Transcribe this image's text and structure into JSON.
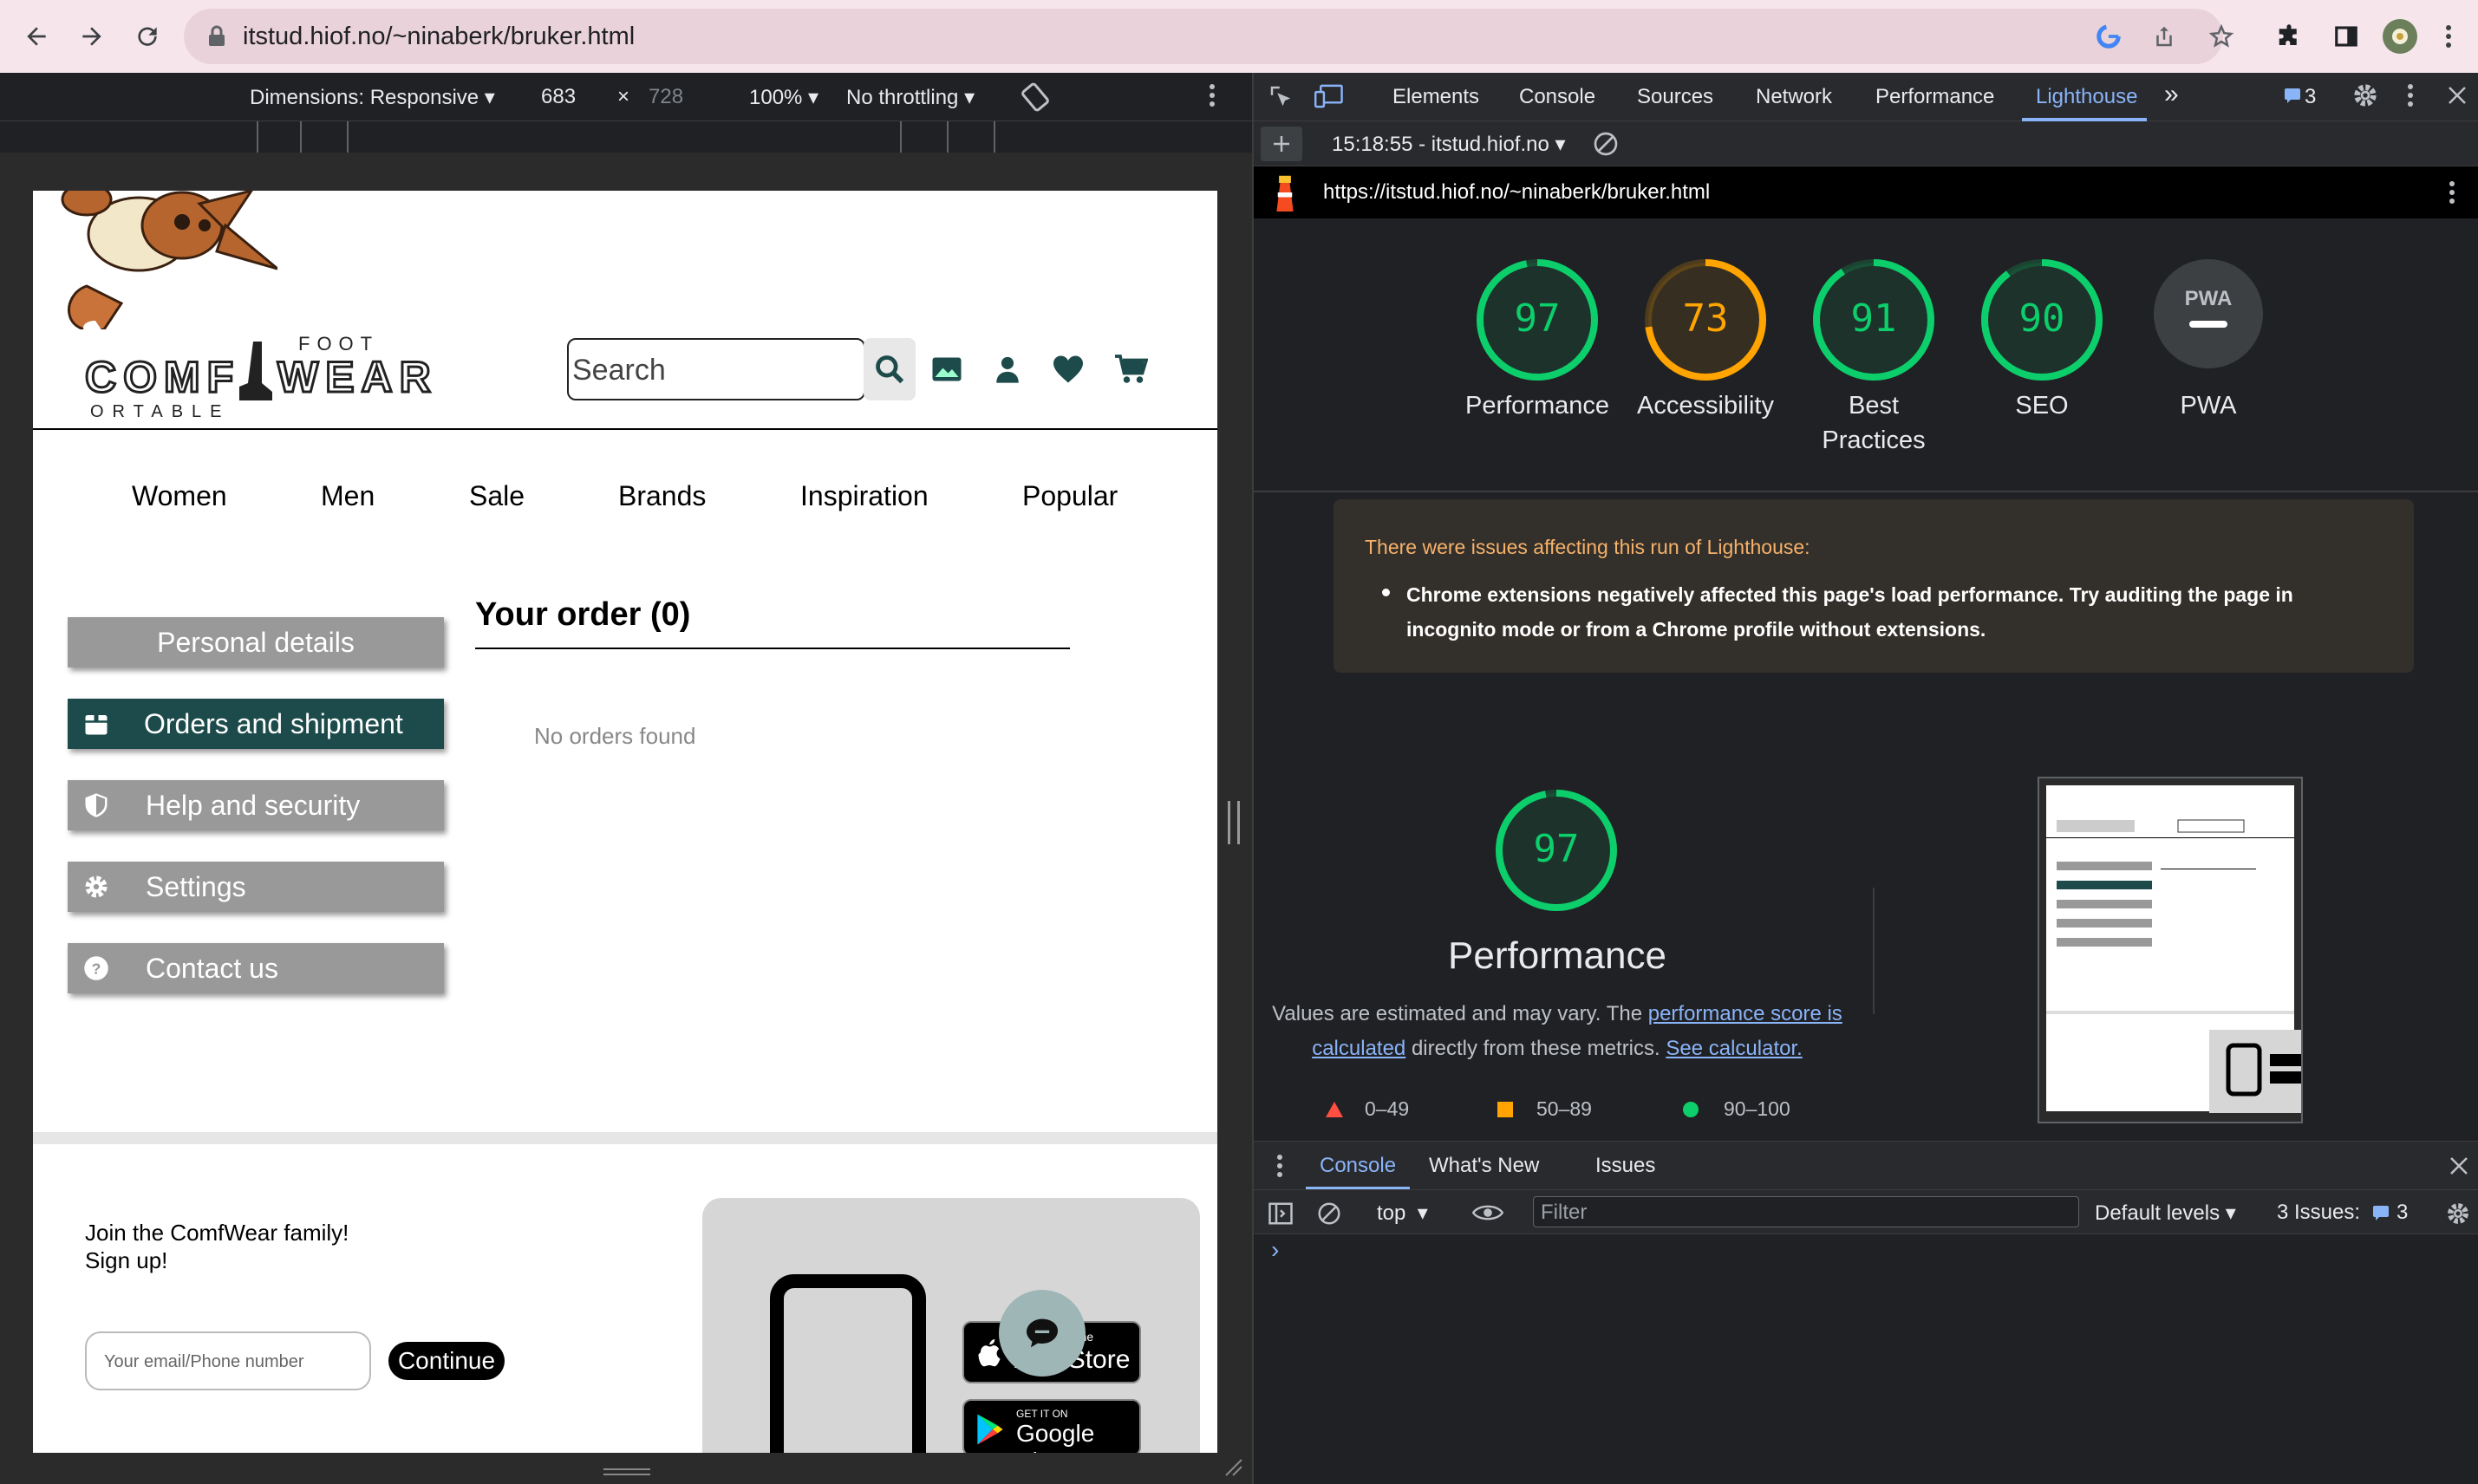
{
  "browser": {
    "url": "itstud.hiof.no/~ninaberk/bruker.html",
    "nav_icons": [
      "back-icon",
      "forward-icon",
      "reload-icon"
    ],
    "toolbar_icons": [
      "google-icon",
      "share-icon",
      "bookmark-star-icon",
      "extensions-icon",
      "sidepanel-icon",
      "profile-avatar",
      "menu-icon"
    ]
  },
  "device_toolbar": {
    "dimensions": "Dimensions: Responsive",
    "width": "683",
    "times": "×",
    "height": "728",
    "zoom": "100%",
    "throttling": "No throttling"
  },
  "site": {
    "logo": {
      "left": "COMF",
      "right": "WEAR",
      "top": "FOOT",
      "bottom": "ORTABLE"
    },
    "search_placeholder": "Search",
    "nav": [
      "Women",
      "Men",
      "Sale",
      "Brands",
      "Inspiration",
      "Popular"
    ],
    "sidebar": [
      {
        "label": "Personal details",
        "icon": "",
        "active": false
      },
      {
        "label": "Orders and shipment",
        "icon": "box-icon",
        "active": true
      },
      {
        "label": "Help and security",
        "icon": "shield-icon",
        "active": false
      },
      {
        "label": "Settings",
        "icon": "gear-icon",
        "active": false
      },
      {
        "label": "Contact us",
        "icon": "question-icon",
        "active": false
      }
    ],
    "order_title": "Your order (0)",
    "no_orders": "No orders found",
    "join_line1": "Join the ComfWear family!",
    "join_line2": "Sign up!",
    "email_placeholder": "Your email/Phone number",
    "continue": "Continue",
    "appstore_small": "n the",
    "appstore_big": "App Store",
    "gplay_small": "GET IT ON",
    "gplay_big": "Google Play"
  },
  "devtools": {
    "tabs": [
      "Elements",
      "Console",
      "Sources",
      "Network",
      "Performance",
      "Lighthouse"
    ],
    "active_tab": "Lighthouse",
    "more": "»",
    "issues_count": "3",
    "report_label": "15:18:55 - itstud.hiof.no",
    "report_url": "https://itstud.hiof.no/~ninaberk/bruker.html",
    "scores": [
      {
        "label": "Performance",
        "value": 97,
        "color": "#0cce6b"
      },
      {
        "label": "Accessibility",
        "value": 73,
        "color": "#ffa400"
      },
      {
        "label": "Best Practices",
        "value": 91,
        "color": "#0cce6b"
      },
      {
        "label": "SEO",
        "value": 90,
        "color": "#0cce6b"
      }
    ],
    "pwa_label": "PWA",
    "pwa_badge": "PWA",
    "warning_title": "There were issues affecting this run of Lighthouse:",
    "warning_text": "Chrome extensions negatively affected this page's load performance. Try auditing the page in incognito mode or from a Chrome profile without extensions.",
    "perf_score": "97",
    "perf_title": "Performance",
    "perf_desc_1": "Values are estimated and may vary. The ",
    "perf_link_1": "performance score is calculated",
    "perf_desc_2": " directly from these metrics. ",
    "perf_link_2": "See calculator.",
    "legend": [
      "0–49",
      "50–89",
      "90–100"
    ],
    "colors": {
      "fail": "#ff4e42",
      "average": "#ffa400",
      "pass": "#0cce6b"
    }
  },
  "console": {
    "tabs": [
      "Console",
      "What's New",
      "Issues"
    ],
    "context": "top",
    "filter_placeholder": "Filter",
    "levels": "Default levels",
    "issues_label": "3 Issues:",
    "issues_count": "3",
    "prompt": "›"
  }
}
